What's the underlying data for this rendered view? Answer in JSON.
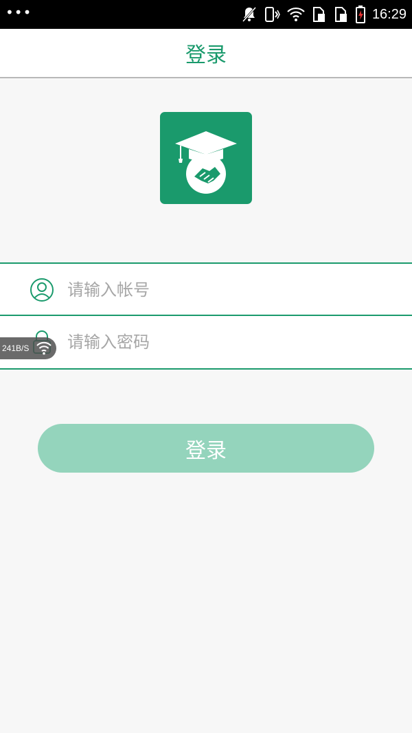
{
  "status_bar": {
    "time": "16:29",
    "icons": [
      "more-dots-icon",
      "bell-muted-icon",
      "vibrate-icon",
      "wifi-icon",
      "sim1-icon",
      "sim2-icon",
      "battery-charging-icon"
    ]
  },
  "header": {
    "title": "登录"
  },
  "logo": {
    "icon": "graduation-cap-handshake-icon",
    "color": "#1a9a6c"
  },
  "form": {
    "account_placeholder": "请输入帐号",
    "password_placeholder": "请输入密码",
    "account_icon": "user-icon",
    "password_icon": "lock-icon"
  },
  "network_badge": {
    "speed": "241B/S"
  },
  "login_button": {
    "label": "登录",
    "color": "#94d4bc"
  },
  "colors": {
    "accent": "#1a9a6c",
    "background": "#f7f7f7"
  }
}
